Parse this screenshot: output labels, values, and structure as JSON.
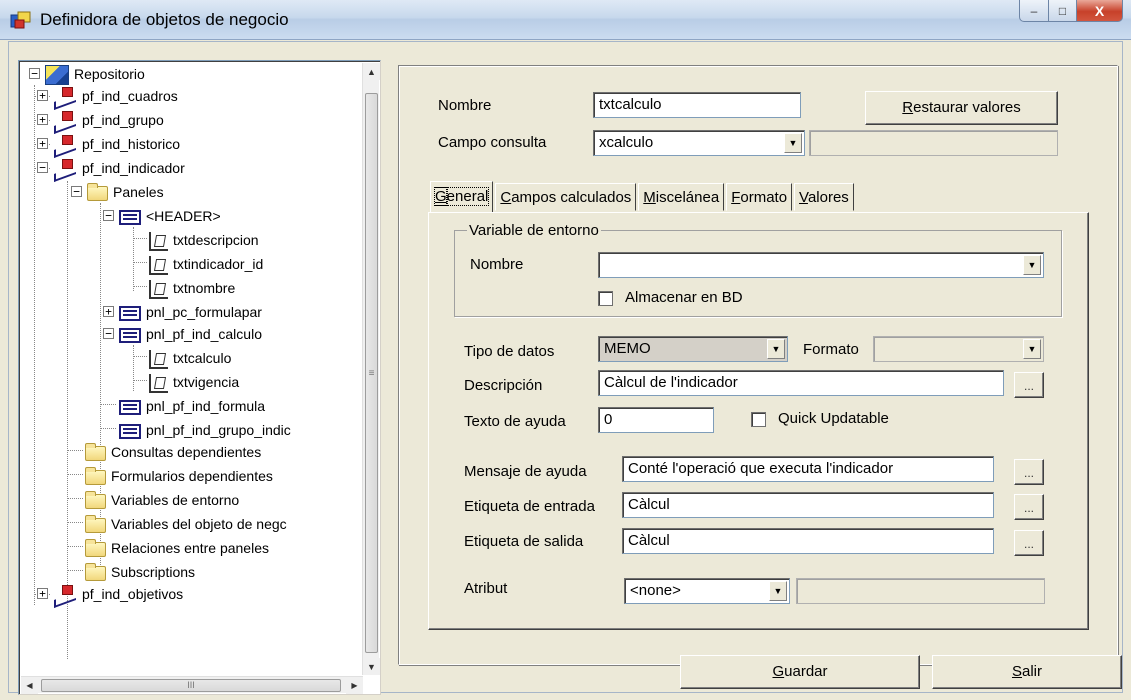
{
  "window": {
    "title": "Definidora de objetos de negocio",
    "controls": {
      "minimize": "–",
      "maximize": "□",
      "close": "X"
    }
  },
  "tree": {
    "root": "Repositorio",
    "items": [
      "pf_ind_cuadros",
      "pf_ind_grupo",
      "pf_ind_historico",
      "pf_ind_indicador",
      "Paneles",
      "<HEADER>",
      "txtdescripcion",
      "txtindicador_id",
      "txtnombre",
      "pnl_pc_formulapar",
      "pnl_pf_ind_calculo",
      "txtcalculo",
      "txtvigencia",
      "pnl_pf_ind_formula",
      "pnl_pf_ind_grupo_indic",
      "Consultas dependientes",
      "Formularios dependientes",
      "Variables de entorno",
      "Variables del objeto de negc",
      "Relaciones entre paneles",
      "Subscriptions",
      "pf_ind_objetivos"
    ],
    "scroll_thumb_grip": "≡",
    "hscroll_grip": "III"
  },
  "form": {
    "nombre_label": "Nombre",
    "nombre_value": "txtcalculo",
    "restaurar_label_u": "R",
    "restaurar_label_rest": "estaurar valores",
    "campo_consulta_label": "Campo consulta",
    "campo_consulta_value": "xcalculo",
    "campo_consulta_extra": ""
  },
  "tabs": [
    {
      "u": "G",
      "rest": "eneral"
    },
    {
      "u": "C",
      "rest": "ampos calculados"
    },
    {
      "u": "M",
      "rest": "iscelánea"
    },
    {
      "u": "F",
      "rest": "ormato"
    },
    {
      "u": "V",
      "rest": "alores"
    }
  ],
  "general": {
    "group_title": "Variable de entorno",
    "var_nombre_label": "Nombre",
    "var_nombre_value": "",
    "almacenar_label": "Almacenar en BD",
    "almacenar_checked": false,
    "tipo_datos_label": "Tipo de datos",
    "tipo_datos_value": "MEMO",
    "formato_label": "Formato",
    "formato_value": "",
    "descripcion_label": "Descripción",
    "descripcion_value": "Càlcul de l'indicador",
    "texto_ayuda_label": "Texto de ayuda",
    "texto_ayuda_value": "0",
    "quick_label": "Quick Updatable",
    "quick_checked": false,
    "mensaje_label": "Mensaje de ayuda",
    "mensaje_value": "Conté l'operació que executa l'indicador",
    "entrada_label": "Etiqueta de entrada",
    "entrada_value": "Càlcul",
    "salida_label": "Etiqueta de salida",
    "salida_value": "Càlcul",
    "atribut_label": "Atribut",
    "atribut_value": "<none>",
    "atribut_extra": "",
    "ellipsis": "...",
    "dropdown_arrow": "▼"
  },
  "buttons": {
    "guardar_u": "G",
    "guardar_rest": "uardar",
    "salir_u": "S",
    "salir_rest": "alir"
  }
}
